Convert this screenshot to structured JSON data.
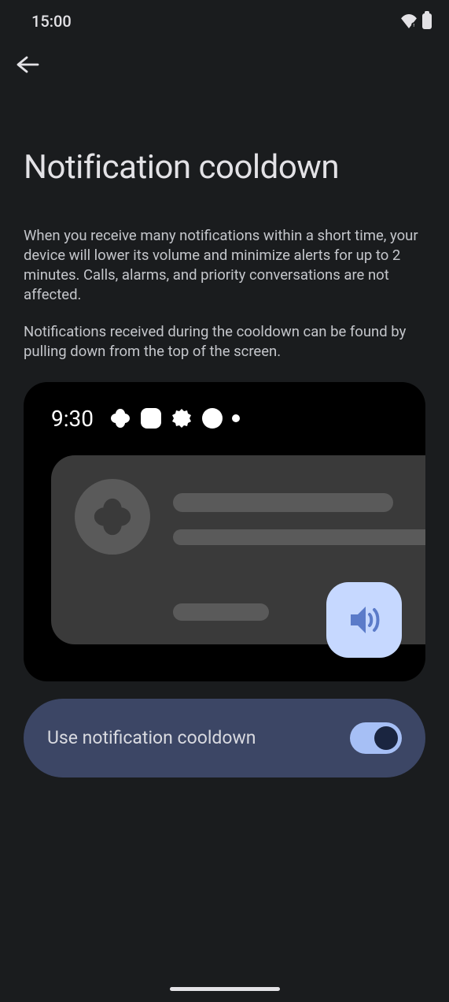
{
  "status_bar": {
    "time": "15:00"
  },
  "page": {
    "title": "Notification cooldown",
    "description_1": "When you receive many notifications within a short time, your device will lower its volume and minimize alerts for up to 2 minutes. Calls, alarms, and priority conversations are not affected.",
    "description_2": "Notifications received during the cooldown can be found by pulling down from the top of the screen."
  },
  "illustration": {
    "time": "9:30"
  },
  "toggle": {
    "label": "Use notification cooldown",
    "enabled": true
  }
}
